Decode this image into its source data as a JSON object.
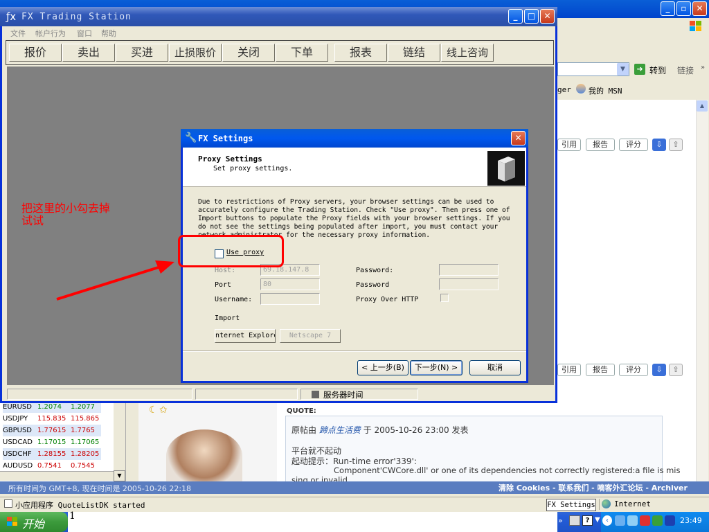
{
  "browser": {
    "goto_label": "转到",
    "links_label": "链接",
    "links_item1": "ger",
    "links_item2": "我的 MSN",
    "forum_buttons": [
      "引用",
      "报告",
      "评分"
    ],
    "quote_label": "QUOTE:",
    "quote_posted_by": "原帖由",
    "quote_author": "蹄点生活费",
    "quote_date": "于 2005-10-26 23:00 发表",
    "quote_line1": "平台就不起动",
    "quote_line2": "起动提示：Run-time  error'339':",
    "quote_line3": "Component'CWCore.dll' or one of its dependencies not correctly registered:a file is mis",
    "quote_line4": "sing or invalid",
    "footer_timezone": "所有时间为  GMT+8, 现在时间是  2005-10-26 22:18",
    "footer_links": "清除  Cookies - 联系我们 - 嘀客外汇论坛 - Archiver"
  },
  "quotes": [
    {
      "sym": "EURUSD",
      "bid": "1.2074",
      "ask": "1.2077",
      "color": "#008000"
    },
    {
      "sym": "USDJPY",
      "bid": "115.835",
      "ask": "115.865",
      "color": "#cc0000"
    },
    {
      "sym": "GBPUSD",
      "bid": "1.77615",
      "ask": "1.7765",
      "color": "#cc0000"
    },
    {
      "sym": "USDCAD",
      "bid": "1.17015",
      "ask": "1.17065",
      "color": "#008000"
    },
    {
      "sym": "USDCHF",
      "bid": "1.28155",
      "ask": "1.28205",
      "color": "#cc0000"
    },
    {
      "sym": "AUDUSD",
      "bid": "0.7541",
      "ask": "0.7545",
      "color": "#cc0000"
    }
  ],
  "fx_window": {
    "title": "FX Trading Station",
    "menu": [
      "文件",
      "帐户行为",
      "窗口",
      "帮助"
    ],
    "toolbar": [
      "报价",
      "卖出",
      "买进",
      "止损限价",
      "关闭",
      "下单",
      "报表",
      "链结",
      "线上咨询"
    ],
    "status_server_time": "服务器时间"
  },
  "settings": {
    "title": "FX Settings",
    "heading": "Proxy Settings",
    "subheading": "Set proxy settings.",
    "description": "Due to restrictions of Proxy servers, your browser settings can be used to accurately configure the Trading Station. Check \"Use proxy\". Then press one of Import buttons to populate the Proxy fields with your browser settings. If you do not see the settings being populated after import, you must contact your network administrator for the necessary proxy information.",
    "use_proxy_label": "Use proxy",
    "host_label": "Host:",
    "host_value": "69.18.147.8",
    "port_label": "Port",
    "port_value": "80",
    "username_label": "Username:",
    "password_label": "Password:",
    "password2_label": "Password",
    "proxy_http_label": "Proxy Over HTTP",
    "import_label": "Import",
    "ie_button": "nternet Explore",
    "netscape_button": "Netscape 7",
    "back_button": "< 上一步(B)",
    "next_button": "下一步(N) >",
    "cancel_button": "取消"
  },
  "annotation": {
    "text1": "把这里的小勾去掉",
    "text2": "试试",
    "color": "#ff0000"
  },
  "statusbar": {
    "text": "小应用程序 QuoteListDK started",
    "zone": "Internet"
  },
  "taskbar": {
    "start_label": "开始",
    "below_text": "1",
    "task_item": "FX Settings",
    "clock": "23:49"
  }
}
